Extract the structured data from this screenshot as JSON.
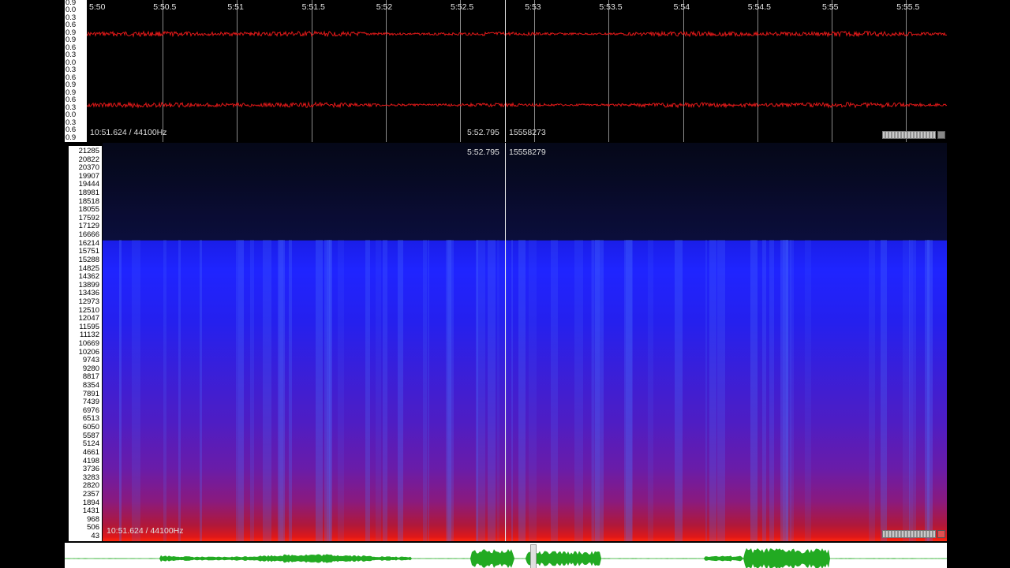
{
  "waveform": {
    "amplitude_labels": [
      "0.9",
      "0.0",
      "0.3",
      "0.6",
      "0.9",
      "0.9",
      "0.6",
      "0.3",
      "0.0",
      "0.3",
      "0.6",
      "0.9",
      "0.9",
      "0.6",
      "0.3",
      "0.0",
      "0.3",
      "0.6",
      "0.9"
    ],
    "time_ticks": [
      "5:50",
      "5:50.5",
      "5:51",
      "5:51.5",
      "5:52",
      "5:52.5",
      "5:53",
      "5:53.5",
      "5:54",
      "5:54.5",
      "5:55",
      "5:55.5"
    ],
    "duration_rate": "10:51.624 / 44100Hz",
    "cursor_time": "5:52.795",
    "cursor_sample": "15558273",
    "wave_color": "#e01818"
  },
  "spectrogram": {
    "freq_labels": [
      "21285",
      "20822",
      "20370",
      "19907",
      "19444",
      "18981",
      "18518",
      "18055",
      "17592",
      "17129",
      "16666",
      "16214",
      "15751",
      "15288",
      "14825",
      "14362",
      "13899",
      "13436",
      "12973",
      "12510",
      "12047",
      "11595",
      "11132",
      "10669",
      "10206",
      "9743",
      "9280",
      "8817",
      "8354",
      "7891",
      "7439",
      "6976",
      "6513",
      "6050",
      "5587",
      "5124",
      "4661",
      "4198",
      "3736",
      "3283",
      "2820",
      "2357",
      "1894",
      "1431",
      "968",
      "506",
      "43"
    ],
    "cursor_time": "5:52.795",
    "cursor_sample": "15558279",
    "duration_rate": "10:51.624 / 44100Hz"
  },
  "overview": {
    "wave_color": "#22aa22"
  },
  "icons": {
    "scroll": "horizontal-scroll-thumb-icon",
    "corner": "corner-button-icon",
    "meter": "level-meter-icon"
  }
}
